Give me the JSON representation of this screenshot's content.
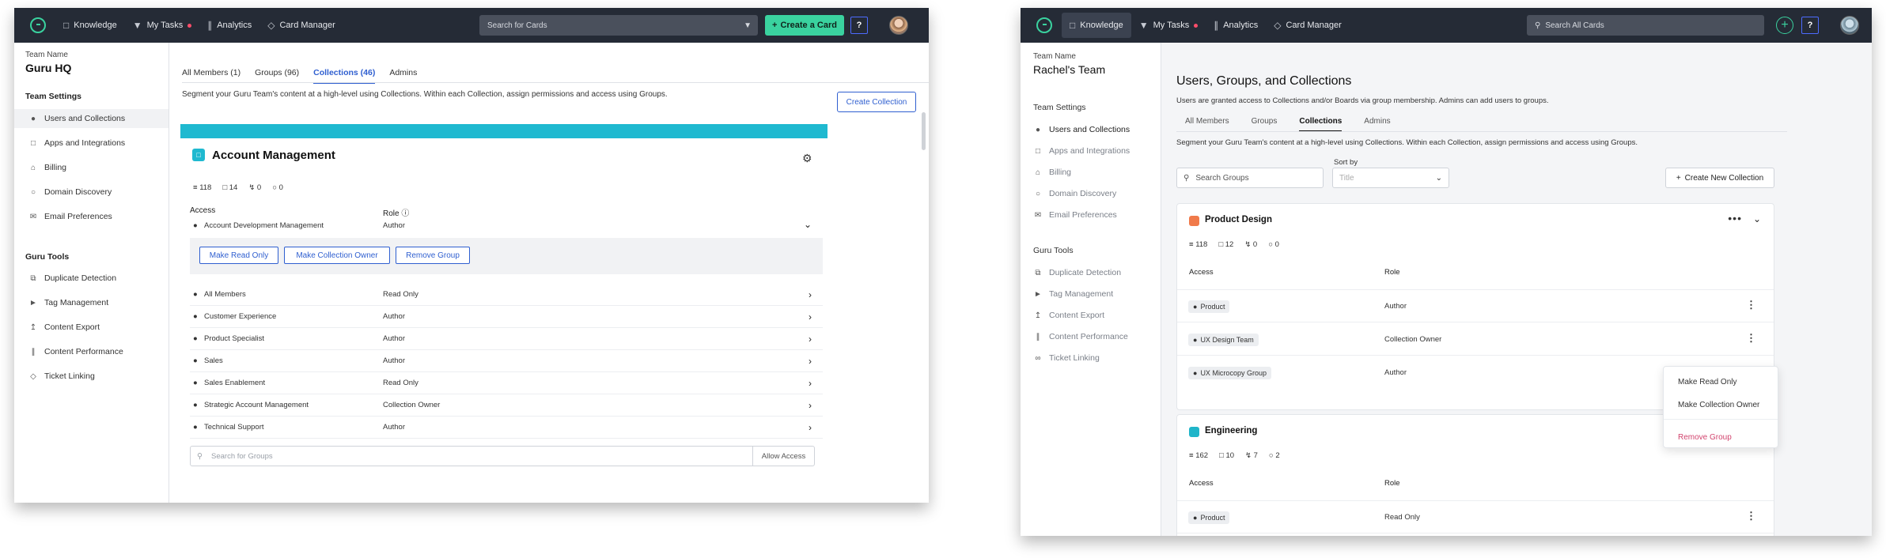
{
  "left": {
    "nav": {
      "items": [
        {
          "icon": "book-icon",
          "label": "Knowledge"
        },
        {
          "icon": "bell-icon",
          "label": "My Tasks"
        },
        {
          "icon": "bar-chart-icon",
          "label": "Analytics"
        },
        {
          "icon": "cube-icon",
          "label": "Card Manager"
        }
      ],
      "search_placeholder": "Search for Cards",
      "create_label": "Create a Card",
      "help_label": "?"
    },
    "sidebar": {
      "team_label": "Team Name",
      "team_name": "Guru HQ",
      "settings_title": "Team Settings",
      "settings": [
        {
          "icon": "users-icon",
          "label": "Users and Collections"
        },
        {
          "icon": "apps-icon",
          "label": "Apps and Integrations"
        },
        {
          "icon": "bank-icon",
          "label": "Billing"
        },
        {
          "icon": "globe-icon",
          "label": "Domain Discovery"
        },
        {
          "icon": "mail-icon",
          "label": "Email Preferences"
        }
      ],
      "tools_title": "Guru Tools",
      "tools": [
        {
          "icon": "duplicate-icon",
          "label": "Duplicate Detection"
        },
        {
          "icon": "tag-icon",
          "label": "Tag Management"
        },
        {
          "icon": "export-icon",
          "label": "Content Export"
        },
        {
          "icon": "bar-chart-icon",
          "label": "Content Performance"
        },
        {
          "icon": "ticket-icon",
          "label": "Ticket Linking"
        }
      ]
    },
    "tabs": [
      "All Members (1)",
      "Groups (96)",
      "Collections (46)",
      "Admins"
    ],
    "active_tab": 2,
    "description": "Segment your Guru Team's content at a high-level using Collections. Within each Collection, assign permissions and access using Groups.",
    "create_collection_label": "Create Collection",
    "collection": {
      "title": "Account Management",
      "stats": [
        "118",
        "14",
        "0",
        "0"
      ],
      "access_header": "Access",
      "role_header": "Role",
      "expanded_group": {
        "name": "Account Development Management",
        "role": "Author"
      },
      "actions": [
        "Make Read Only",
        "Make Collection Owner",
        "Remove Group"
      ],
      "groups": [
        {
          "name": "All Members",
          "role": "Read Only"
        },
        {
          "name": "Customer Experience",
          "role": "Author"
        },
        {
          "name": "Product Specialist",
          "role": "Author"
        },
        {
          "name": "Sales",
          "role": "Author"
        },
        {
          "name": "Sales Enablement",
          "role": "Read Only"
        },
        {
          "name": "Strategic Account Management",
          "role": "Collection Owner"
        },
        {
          "name": "Technical Support",
          "role": "Author"
        }
      ],
      "search_placeholder": "Search for Groups",
      "allow_access_label": "Allow Access"
    }
  },
  "right": {
    "nav": {
      "items": [
        {
          "icon": "book-icon",
          "label": "Knowledge"
        },
        {
          "icon": "bell-icon",
          "label": "My Tasks"
        },
        {
          "icon": "bar-chart-icon",
          "label": "Analytics"
        },
        {
          "icon": "cube-icon",
          "label": "Card Manager"
        }
      ],
      "search_placeholder": "Search All Cards",
      "help_label": "?"
    },
    "sidebar": {
      "team_label": "Team Name",
      "team_name": "Rachel's Team",
      "settings_title": "Team Settings",
      "settings": [
        {
          "icon": "users-icon",
          "label": "Users and Collections"
        },
        {
          "icon": "apps-icon",
          "label": "Apps and Integrations"
        },
        {
          "icon": "bank-icon",
          "label": "Billing"
        },
        {
          "icon": "globe-icon",
          "label": "Domain Discovery"
        },
        {
          "icon": "mail-icon",
          "label": "Email Preferences"
        }
      ],
      "tools_title": "Guru Tools",
      "tools": [
        {
          "icon": "duplicate-icon",
          "label": "Duplicate Detection"
        },
        {
          "icon": "tag-icon",
          "label": "Tag Management"
        },
        {
          "icon": "export-icon",
          "label": "Content Export"
        },
        {
          "icon": "bar-chart-icon",
          "label": "Content Performance"
        },
        {
          "icon": "link-icon",
          "label": "Ticket Linking"
        }
      ]
    },
    "page_title": "Users, Groups, and Collections",
    "subtitle": "Users are granted access to Collections and/or Boards via group membership. Admins can add users to groups.",
    "tabs": [
      "All Members",
      "Groups",
      "Collections",
      "Admins"
    ],
    "active_tab": 2,
    "description": "Segment your Guru Team's content at a high-level using Collections. Within each Collection, assign permissions and access using Groups.",
    "search_placeholder": "Search Groups",
    "sort_label": "Sort by",
    "sort_placeholder": "Title",
    "create_label": "Create New Collection",
    "collections": [
      {
        "title": "Product Design",
        "color": "#f07a4a",
        "stats": [
          "118",
          "12",
          "0",
          "0"
        ],
        "access_header": "Access",
        "role_header": "Role",
        "groups": [
          {
            "name": "Product",
            "role": "Author"
          },
          {
            "name": "UX Design Team",
            "role": "Collection Owner"
          },
          {
            "name": "UX Microcopy Group",
            "role": "Author"
          }
        ]
      },
      {
        "title": "Engineering",
        "color": "#1fb5c9",
        "stats": [
          "162",
          "10",
          "7",
          "2"
        ],
        "access_header": "Access",
        "role_header": "Role",
        "groups": [
          {
            "name": "Product",
            "role": "Read Only"
          }
        ]
      }
    ],
    "menu": {
      "items": [
        "Make Read Only",
        "Make Collection Owner"
      ],
      "danger": "Remove Group"
    }
  }
}
